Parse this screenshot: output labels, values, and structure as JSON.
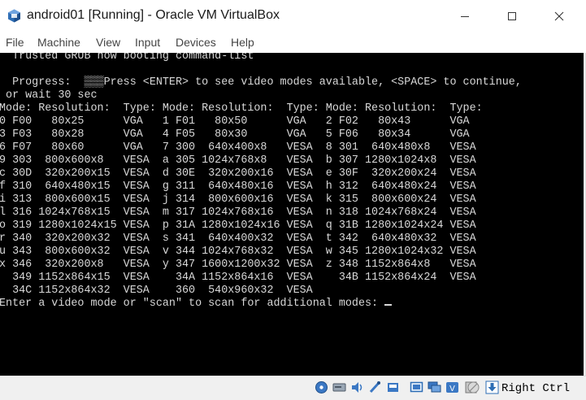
{
  "window": {
    "title": "android01 [Running] - Oracle VM VirtualBox"
  },
  "menu": [
    "File",
    "Machine",
    "View",
    "Input",
    "Devices",
    "Help"
  ],
  "console": {
    "lines": [
      "  Trusted GRUB now booting command-list",
      "",
      "  Progress:  ▒▒▒Press <ENTER> to see video modes available, <SPACE> to continue,",
      " or wait 30 sec",
      "Mode: Resolution:  Type: Mode: Resolution:  Type: Mode: Resolution:  Type:",
      "0 F00   80x25      VGA   1 F01   80x50      VGA   2 F02   80x43      VGA",
      "3 F03   80x28      VGA   4 F05   80x30      VGA   5 F06   80x34      VGA",
      "6 F07   80x60      VGA   7 300  640x400x8   VESA  8 301  640x480x8   VESA",
      "9 303  800x600x8   VESA  a 305 1024x768x8   VESA  b 307 1280x1024x8  VESA",
      "c 30D  320x200x15  VESA  d 30E  320x200x16  VESA  e 30F  320x200x24  VESA",
      "f 310  640x480x15  VESA  g 311  640x480x16  VESA  h 312  640x480x24  VESA",
      "i 313  800x600x15  VESA  j 314  800x600x16  VESA  k 315  800x600x24  VESA",
      "l 316 1024x768x15  VESA  m 317 1024x768x16  VESA  n 318 1024x768x24  VESA",
      "o 319 1280x1024x15 VESA  p 31A 1280x1024x16 VESA  q 31B 1280x1024x24 VESA",
      "r 340  320x200x32  VESA  s 341  640x400x32  VESA  t 342  640x480x32  VESA",
      "u 343  800x600x32  VESA  v 344 1024x768x32  VESA  w 345 1280x1024x32 VESA",
      "x 346  320x200x8   VESA  y 347 1600x1200x32 VESA  z 348 1152x864x8   VESA",
      "  349 1152x864x15  VESA    34A 1152x864x16  VESA    34B 1152x864x24  VESA",
      "  34C 1152x864x32  VESA    360  540x960x32  VESA",
      "Enter a video mode or \"scan\" to scan for additional modes: "
    ]
  },
  "statusbar": {
    "host_key": "Right Ctrl",
    "icons": [
      "hard-disk-icon",
      "optical-drive-icon",
      "audio-icon",
      "network-icon",
      "usb-icon",
      "shared-folders-icon",
      "display-icon",
      "recording-icon",
      "virtualization-icon",
      "mouse-integration-icon",
      "download-arrow-icon"
    ]
  }
}
